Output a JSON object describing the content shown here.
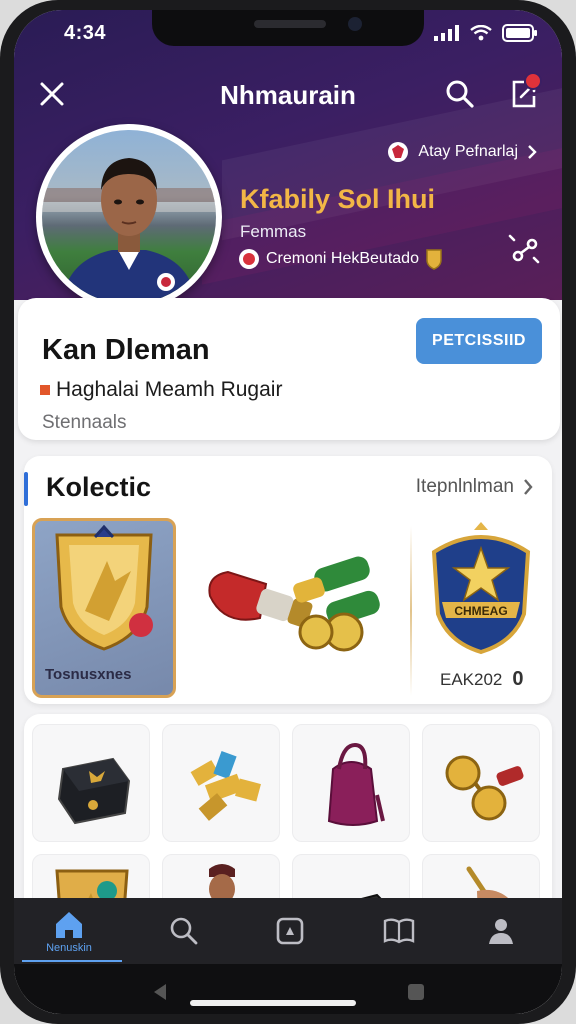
{
  "status_bar": {
    "time": "4:34"
  },
  "header": {
    "title": "Nhmaurain",
    "link_label": "Atay Pefnarlaj",
    "hero_name": "Kfabily Sol Ihui",
    "hero_subtitle": "Femmas",
    "hero_row": "Cremoni HekBeutado"
  },
  "profile": {
    "name": "Kan Dleman",
    "meta": "Haghalai Meamh Rugair",
    "status": "Stennaals",
    "action_label": "PETCISSIID"
  },
  "collection": {
    "title": "Kolectic",
    "see_all_label": "Itepnlnlman",
    "featured_label": "Tosnusxnes",
    "badge_text": "CHMEAG",
    "badge_caption": "EAK202",
    "badge_count": "0"
  },
  "grid": {
    "items": [
      {
        "icon": "chest-icon"
      },
      {
        "icon": "gold-bars-icon"
      },
      {
        "icon": "bag-icon"
      },
      {
        "icon": "medallion-icon"
      },
      {
        "icon": "shield-icon"
      },
      {
        "icon": "player-figure-icon"
      },
      {
        "icon": "case-icon"
      },
      {
        "icon": "hand-icon"
      }
    ]
  },
  "bottom_nav": {
    "items": [
      {
        "label": "Nenuskin",
        "icon": "home-icon",
        "active": true
      },
      {
        "label": "",
        "icon": "search-icon"
      },
      {
        "label": "",
        "icon": "camera-icon"
      },
      {
        "label": "",
        "icon": "book-icon"
      },
      {
        "label": "",
        "icon": "user-icon"
      }
    ]
  },
  "colors": {
    "accent": "#4a90d9",
    "hero_gold": "#f2b646",
    "hero_background": "#3b1f63",
    "nav_active": "#5ea1f0"
  }
}
